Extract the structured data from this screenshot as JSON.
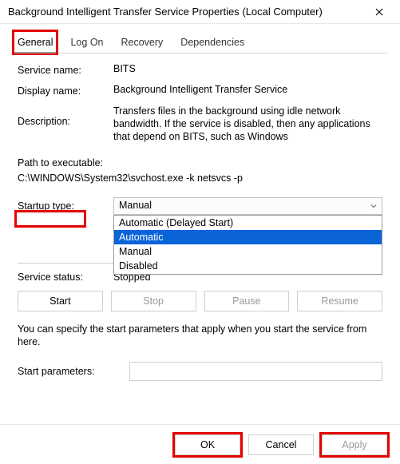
{
  "window": {
    "title": "Background Intelligent Transfer Service Properties (Local Computer)"
  },
  "tabs": {
    "general": "General",
    "logon": "Log On",
    "recovery": "Recovery",
    "dependencies": "Dependencies"
  },
  "fields": {
    "service_name_label": "Service name:",
    "service_name": "BITS",
    "display_name_label": "Display name:",
    "display_name": "Background Intelligent Transfer Service",
    "description_label": "Description:",
    "description": "Transfers files in the background using idle network bandwidth. If the service is disabled, then any applications that depend on BITS, such as Windows",
    "path_label": "Path to executable:",
    "path": "C:\\WINDOWS\\System32\\svchost.exe -k netsvcs -p",
    "startup_label": "Startup type:",
    "startup_selected": "Manual",
    "service_status_label": "Service status:",
    "service_status": "Stopped",
    "hint": "You can specify the start parameters that apply when you start the service from here.",
    "start_params_label": "Start parameters:",
    "start_params_value": ""
  },
  "dropdown": {
    "opt_delayed": "Automatic (Delayed Start)",
    "opt_auto": "Automatic",
    "opt_manual": "Manual",
    "opt_disabled": "Disabled"
  },
  "buttons": {
    "start": "Start",
    "stop": "Stop",
    "pause": "Pause",
    "resume": "Resume",
    "ok": "OK",
    "cancel": "Cancel",
    "apply": "Apply"
  }
}
